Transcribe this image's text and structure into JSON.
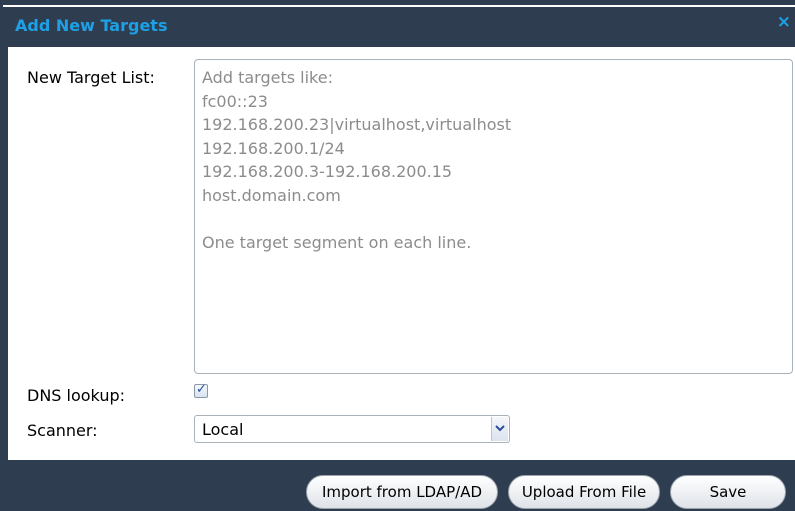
{
  "dialog": {
    "title": "Add New Targets",
    "close_glyph": "×"
  },
  "form": {
    "target_list_label": "New Target List:",
    "target_list_placeholder": [
      "Add targets like:",
      "fc00::23",
      "192.168.200.23|virtualhost,virtualhost",
      "192.168.200.1/24",
      "192.168.200.3-192.168.200.15",
      "host.domain.com",
      "",
      "One target segment on each line."
    ],
    "dns_lookup_label": "DNS lookup:",
    "dns_lookup_checked": true,
    "scanner_label": "Scanner:",
    "scanner_value": "Local"
  },
  "footer": {
    "import_ldap_label": "Import from LDAP/AD",
    "upload_file_label": "Upload From File",
    "save_label": "Save"
  },
  "colors": {
    "title_accent": "#1ea0e6",
    "frame": "#2e3e50"
  }
}
